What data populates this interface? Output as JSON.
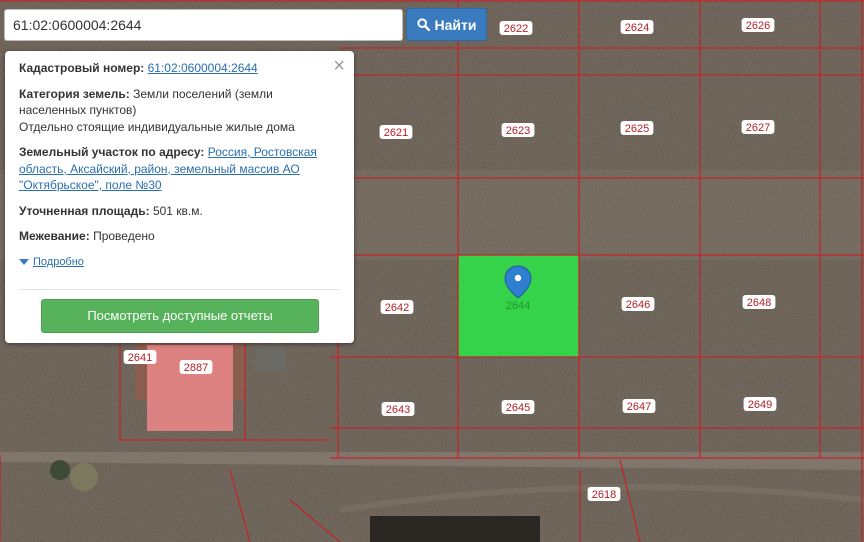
{
  "search": {
    "value": "61:02:0600004:2644",
    "button_label": "Найти"
  },
  "map": {
    "parcels": [
      {
        "label": "2622"
      },
      {
        "label": "2624"
      },
      {
        "label": "2626"
      },
      {
        "label": "2621"
      },
      {
        "label": "2623"
      },
      {
        "label": "2625"
      },
      {
        "label": "2627"
      },
      {
        "label": "2642"
      },
      {
        "label": "2644",
        "selected": true
      },
      {
        "label": "2646"
      },
      {
        "label": "2648"
      },
      {
        "label": "2641"
      },
      {
        "label": "2887"
      },
      {
        "label": "2643"
      },
      {
        "label": "2645"
      },
      {
        "label": "2647"
      },
      {
        "label": "2649"
      },
      {
        "label": "2618"
      }
    ],
    "colors": {
      "boundary": "#c0262d",
      "selected_fill": "#31d94a",
      "building_fill": "#e48585",
      "marker": "#2f7fd0"
    }
  },
  "popup": {
    "cadastral_label": "Кадастровый номер:",
    "cadastral_value": "61:02:0600004:2644",
    "category_label": "Категория земель:",
    "category_value": "Земли поселений (земли населенных пунктов)",
    "category_use": "Отдельно стоящие индивидуальные жилые дома",
    "address_label": "Земельный участок по адресу:",
    "address_value": "Россия, Ростовская область, Аксайский, район, земельный массив АО \"Октябрьское\", поле №30",
    "area_label": "Уточненная площадь:",
    "area_value": "501 кв.м.",
    "survey_label": "Межевание:",
    "survey_value": "Проведено",
    "details_link": "Подробно",
    "reports_button": "Посмотреть доступные отчеты",
    "close_glyph": "×"
  }
}
